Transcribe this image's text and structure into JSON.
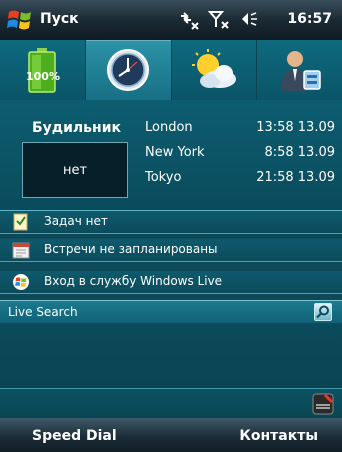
{
  "titlebar": {
    "start_label": "Пуск",
    "time": "16:57"
  },
  "tabs": [
    {
      "name": "battery",
      "icon": "battery-icon",
      "label": "100%"
    },
    {
      "name": "clock",
      "icon": "clock-icon",
      "active": true
    },
    {
      "name": "weather",
      "icon": "weather-icon"
    },
    {
      "name": "contacts",
      "icon": "contact-card-icon"
    }
  ],
  "alarm": {
    "title": "Будильник",
    "value": "нет"
  },
  "world_clock": [
    {
      "city": "London",
      "time": "13:58 13.09"
    },
    {
      "city": "New York",
      "time": "8:58 13.09"
    },
    {
      "city": "Tokyo",
      "time": "21:58 13.09"
    }
  ],
  "rows": {
    "tasks": "Задач нет",
    "meetings": "Встречи не запланированы",
    "windows_live": "Вход в службу Windows Live"
  },
  "search": {
    "placeholder": "Live Search"
  },
  "softkeys": {
    "left": "Speed Dial",
    "right": "Контакты"
  },
  "colors": {
    "background": "#0c4a5a",
    "accent": "#2c93a8",
    "titlebar": "#1b2a34"
  }
}
